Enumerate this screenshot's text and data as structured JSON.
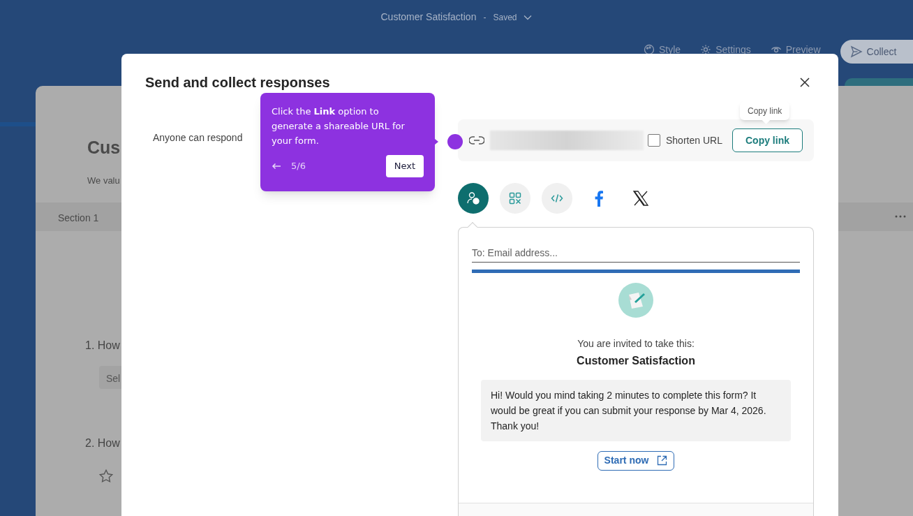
{
  "header": {
    "title": "Customer Satisfaction",
    "separator": "-",
    "status": "Saved"
  },
  "toolbar": [
    {
      "kind": "style",
      "label": "Style"
    },
    {
      "kind": "settings",
      "label": "Settings"
    },
    {
      "kind": "preview",
      "label": "Preview"
    },
    {
      "kind": "collect",
      "label": "Collect"
    }
  ],
  "background_form": {
    "title": "Cus",
    "description": "We valu",
    "section": "Section 1",
    "questions": [
      {
        "kind": "choice",
        "label": "1. How",
        "button": "Sel"
      },
      {
        "kind": "rating",
        "label": "2. How"
      }
    ]
  },
  "dialog": {
    "title": "Send and collect responses",
    "audience": "Anyone can respond",
    "shorten_url": {
      "label": "Shorten URL",
      "checked": false
    },
    "copy_button": "Copy link",
    "copy_tooltip": "Copy link",
    "share_options": [
      {
        "kind": "invite",
        "selected": true
      },
      {
        "kind": "qr",
        "selected": false
      },
      {
        "kind": "embed",
        "selected": false
      },
      {
        "kind": "facebook",
        "selected": false
      },
      {
        "kind": "x",
        "selected": false
      }
    ],
    "email": {
      "placeholder": "To: Email address...",
      "invite_line": "You are invited to take this:",
      "form_title": "Customer Satisfaction",
      "message": "Hi! Would you mind taking 2 minutes to complete this form? It would be great if you can submit your response by Mar 4, 2026. Thank you!",
      "start_button": "Start now"
    }
  },
  "tour": {
    "text": "Click the **Link** option to generate a shareable URL for your form.",
    "step": "5/6",
    "next": "Next"
  }
}
